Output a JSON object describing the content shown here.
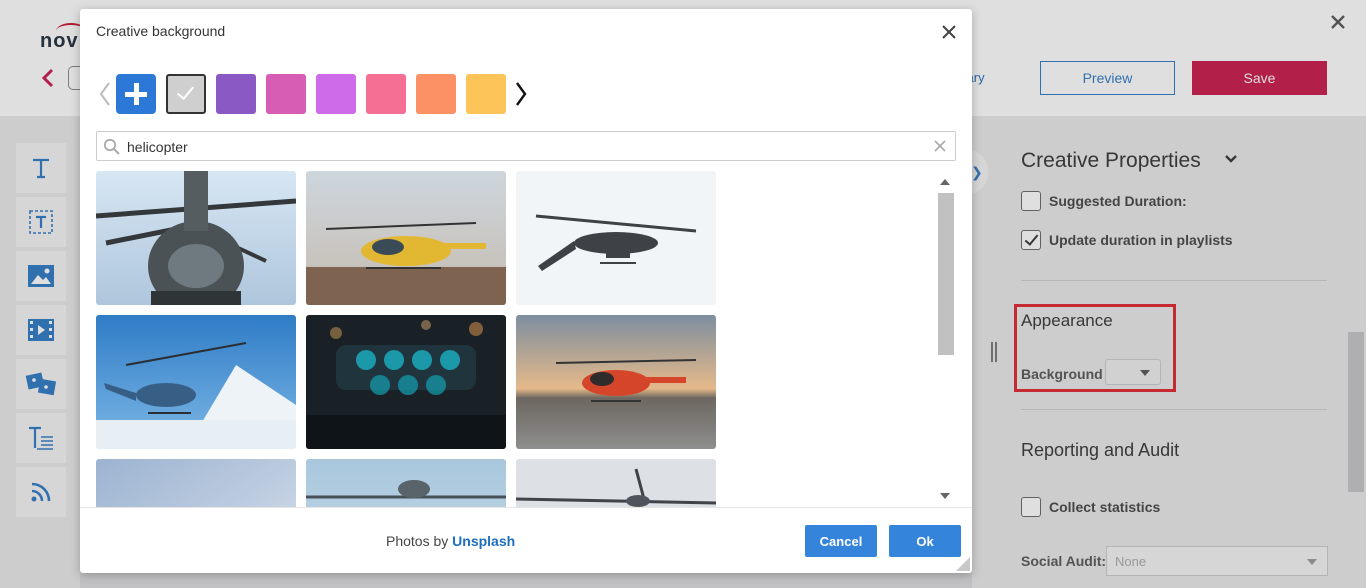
{
  "app": {
    "logo_text": "nov",
    "library_link": "brary",
    "preview_label": "Preview",
    "save_label": "Save",
    "brand_color": "#c8174a",
    "link_color": "#2b78c5"
  },
  "toolbar": {
    "tools": [
      {
        "icon": "text-icon"
      },
      {
        "icon": "text-field-icon"
      },
      {
        "icon": "image-icon"
      },
      {
        "icon": "video-icon"
      },
      {
        "icon": "slideshow-icon"
      },
      {
        "icon": "text-block-icon"
      },
      {
        "icon": "rss-icon"
      }
    ]
  },
  "properties_panel": {
    "title": "Creative Properties",
    "suggested_duration_label": "Suggested Duration:",
    "suggested_duration_checked": false,
    "update_duration_label": "Update duration in playlists",
    "update_duration_checked": true,
    "appearance_title": "Appearance",
    "background_label": "Background",
    "reporting_title": "Reporting and Audit",
    "collect_statistics_label": "Collect statistics",
    "collect_statistics_checked": false,
    "social_audit_label": "Social Audit:",
    "social_audit_value": "None"
  },
  "modal": {
    "title": "Creative background",
    "swatches": [
      {
        "name": "add-color",
        "color": "#2b78d6"
      },
      {
        "name": "light-gray",
        "color": "#cfcfcf",
        "selected": true
      },
      {
        "name": "purple",
        "color": "#8a59c3"
      },
      {
        "name": "magenta",
        "color": "#d65db3"
      },
      {
        "name": "violet",
        "color": "#cd6be8"
      },
      {
        "name": "pink",
        "color": "#f56e94"
      },
      {
        "name": "orange",
        "color": "#fb9164"
      },
      {
        "name": "yellow",
        "color": "#fdc45a"
      }
    ],
    "search": {
      "value": "helicopter",
      "placeholder": ""
    },
    "photos": [
      {
        "name": "military-helicopter-front"
      },
      {
        "name": "adac-yellow-helicopter"
      },
      {
        "name": "apache-helicopter-white-sky"
      },
      {
        "name": "helicopter-snow-mountain"
      },
      {
        "name": "cockpit-instruments-night"
      },
      {
        "name": "red-helicopter-sunset"
      },
      {
        "name": "sky-photo-partial"
      },
      {
        "name": "helicopter-rotor-partial"
      },
      {
        "name": "helicopter-rotor-gray-partial"
      }
    ],
    "credit_prefix": "Photos by",
    "credit_link": "Unsplash",
    "cancel_label": "Cancel",
    "ok_label": "Ok",
    "button_color": "#3584db"
  }
}
